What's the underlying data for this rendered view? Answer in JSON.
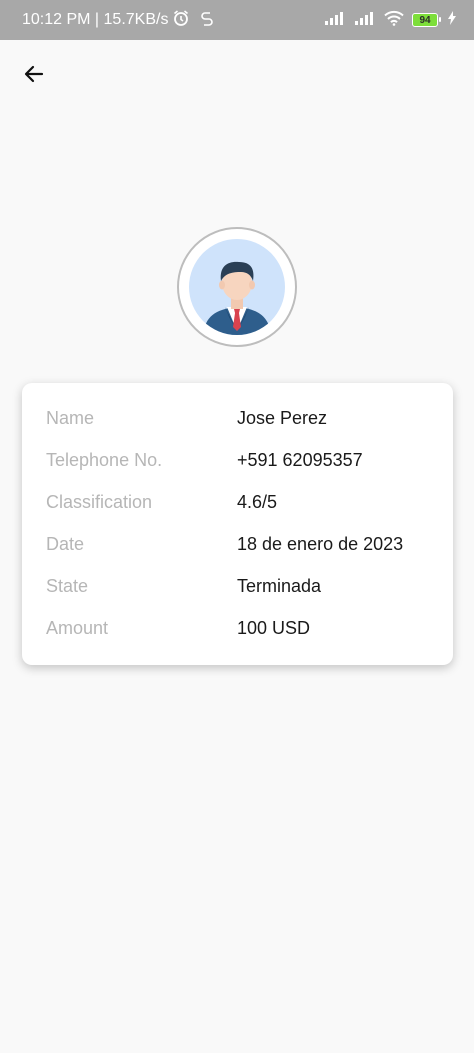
{
  "status_bar": {
    "time_speed": "10:12 PM | 15.7KB/s",
    "battery": "94",
    "icons": [
      "alarm-icon",
      "sync-icon",
      "signal-icon",
      "signal-icon",
      "wifi-icon",
      "battery-icon",
      "charging-icon"
    ]
  },
  "header": {
    "back_icon": "arrow-left-icon"
  },
  "profile": {
    "avatar_icon": "businessman-avatar"
  },
  "details": [
    {
      "label": "Name",
      "value": "Jose Perez"
    },
    {
      "label": "Telephone No.",
      "value": "+591 62095357"
    },
    {
      "label": "Classification",
      "value": "4.6/5"
    },
    {
      "label": "Date",
      "value": "18 de enero de 2023"
    },
    {
      "label": "State",
      "value": "Terminada"
    },
    {
      "label": "Amount",
      "value": "100 USD"
    }
  ],
  "colors": {
    "status_bar": "#a8a8a8",
    "background": "#f9f9f9",
    "label": "#b6b6b6",
    "value": "#1a1a1a",
    "battery": "#7dde3a"
  }
}
